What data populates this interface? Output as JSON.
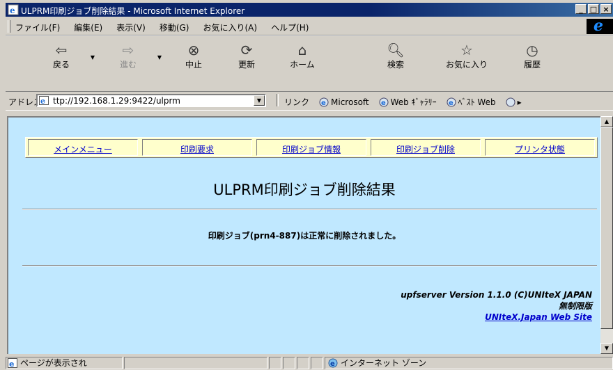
{
  "window": {
    "title": "ULPRM印刷ジョブ削除結果 - Microsoft Internet Explorer",
    "buttons": {
      "minimize": "_",
      "maximize": "□",
      "close": "×"
    }
  },
  "menu": [
    "ファイル(F)",
    "編集(E)",
    "表示(V)",
    "移動(G)",
    "お気に入り(A)",
    "ヘルプ(H)"
  ],
  "toolbar": {
    "back": "戻る",
    "forward": "進む",
    "stop": "中止",
    "refresh": "更新",
    "home": "ホーム",
    "search": "検索",
    "favorites": "お気に入り",
    "history": "履歴"
  },
  "address": {
    "label": "アドレス",
    "url": "ttp://192.168.1.29:9422/ulprm"
  },
  "links": {
    "label": "リンク",
    "items": [
      "Microsoft",
      "Web ｷﾞｬﾗﾘｰ",
      "ﾍﾞｽﾄ Web"
    ]
  },
  "page": {
    "nav": [
      "メインメニュー",
      "印刷要求",
      "印刷ジョブ情報",
      "印刷ジョブ削除",
      "プリンタ状態"
    ],
    "heading": "ULPRM印刷ジョブ削除結果",
    "message": "印刷ジョブ(prn4-887)は正常に削除されました。",
    "footer": {
      "version": "upfserver Version 1.1.0 (C)UNIteX JAPAN",
      "license": "無制限版",
      "link": "UNIteX.Japan Web Site"
    }
  },
  "status": {
    "text": "ページが表示され",
    "zone": "インターネット ゾーン"
  },
  "colors": {
    "title_bar": "#0a246a",
    "content_bg": "#c0e8ff",
    "nav_bg": "#ffffcc",
    "link": "#0000cc"
  }
}
